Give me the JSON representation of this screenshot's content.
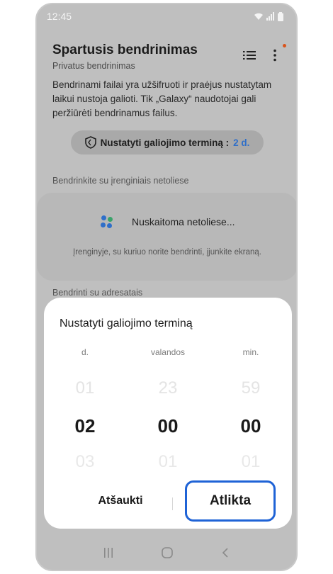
{
  "status_bar": {
    "time": "12:45"
  },
  "header": {
    "title": "Spartusis bendrinimas",
    "subtitle": "Privatus bendrinimas"
  },
  "description": "Bendrinami failai yra užšifruoti ir praėjus nustatytam laikui nustoja galioti. Tik „Galaxy“ naudotojai gali peržiūrėti bendrinamus failus.",
  "expiry_pill": {
    "label": "Nustatyti galiojimo terminą :",
    "value": "2 d."
  },
  "nearby": {
    "section_label": "Bendrinkite su įrenginiais netoliese",
    "scanning_text": "Nuskaitoma netoliese...",
    "hint": "Įrenginyje, su kuriuo norite bendrinti, įjunkite ekraną."
  },
  "contacts": {
    "section_label": "Bendrinti su adresatais"
  },
  "dialog": {
    "title": "Nustatyti galiojimo terminą",
    "columns": [
      {
        "label": "d.",
        "prev": "01",
        "selected": "02",
        "next": "03"
      },
      {
        "label": "valandos",
        "prev": "23",
        "selected": "00",
        "next": "01"
      },
      {
        "label": "min.",
        "prev": "59",
        "selected": "00",
        "next": "01"
      }
    ],
    "cancel_label": "Atšaukti",
    "done_label": "Atlikta"
  },
  "colors": {
    "accent": "#2f6fc9",
    "highlight_border": "#1f63d6",
    "notification_dot": "#d9541c"
  }
}
